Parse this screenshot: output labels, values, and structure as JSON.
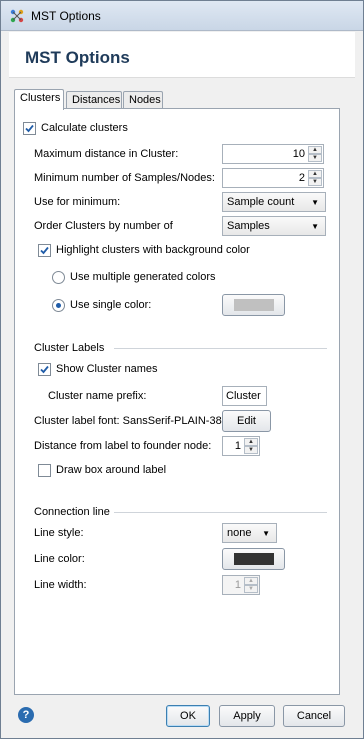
{
  "window": {
    "title": "MST Options"
  },
  "header": {
    "title": "MST Options"
  },
  "tabs": [
    {
      "label": "Clusters",
      "active": true
    },
    {
      "label": "Distances",
      "active": false
    },
    {
      "label": "Nodes",
      "active": false
    }
  ],
  "clusters": {
    "calculate_label": "Calculate clusters",
    "calculate_checked": true,
    "max_distance_label": "Maximum distance in Cluster:",
    "max_distance_value": "10",
    "min_samples_label": "Minimum number of Samples/Nodes:",
    "min_samples_value": "2",
    "use_min_label": "Use for minimum:",
    "use_min_value": "Sample count",
    "order_label": "Order Clusters by number of",
    "order_value": "Samples",
    "highlight_label": "Highlight clusters with background color",
    "highlight_checked": true,
    "multi_colors_label": "Use multiple generated colors",
    "single_color_label": "Use single color:",
    "single_color_selected": true,
    "single_color_value": "#c0c0c0"
  },
  "cluster_labels": {
    "section_title": "Cluster Labels",
    "show_names_label": "Show Cluster names",
    "show_names_checked": true,
    "prefix_label": "Cluster name prefix:",
    "prefix_value": "Cluster",
    "font_label": "Cluster label font: SansSerif-PLAIN-38",
    "edit_label": "Edit",
    "distance_label": "Distance from label to founder node:",
    "distance_value": "1",
    "draw_box_label": "Draw box around label",
    "draw_box_checked": false
  },
  "connection_line": {
    "section_title": "Connection line",
    "style_label": "Line style:",
    "style_value": "none",
    "color_label": "Line color:",
    "color_value": "#333333",
    "width_label": "Line width:",
    "width_value": "1"
  },
  "footer": {
    "help_icon": "?",
    "ok_label": "OK",
    "apply_label": "Apply",
    "cancel_label": "Cancel"
  }
}
